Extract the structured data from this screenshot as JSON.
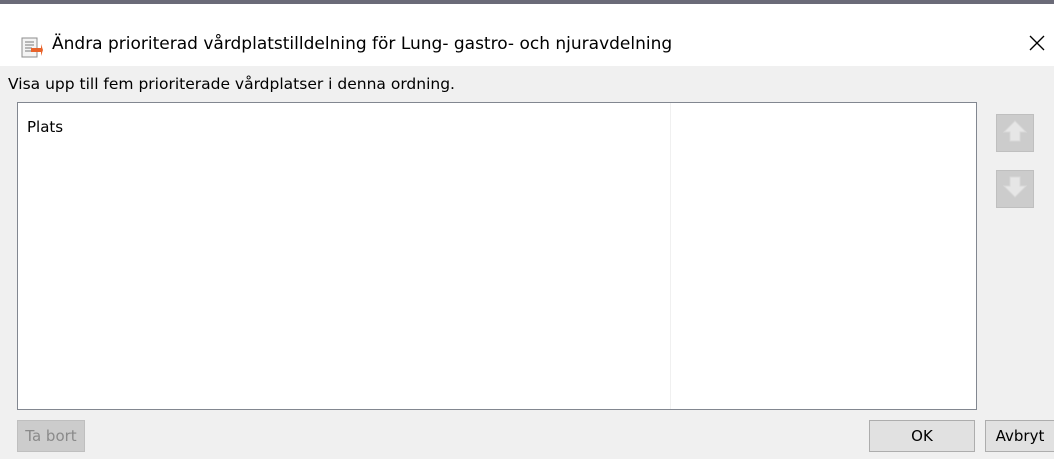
{
  "window": {
    "title": "Ändra prioriterad vårdplatstilldelning för Lung- gastro- och njuravdelning",
    "app_icon": "form-edit-icon",
    "close_icon": "close-icon"
  },
  "content": {
    "instruction": "Visa upp till fem prioriterade vårdplatser i denna ordning.",
    "list": {
      "column_header": "Plats",
      "rows": []
    },
    "move_up_icon": "arrow-up-icon",
    "move_down_icon": "arrow-down-icon"
  },
  "buttons": {
    "remove": "Ta bort",
    "ok": "OK",
    "cancel": "Avbryt"
  },
  "colors": {
    "accent": "#e8632b",
    "disabled": "#cccccc"
  }
}
